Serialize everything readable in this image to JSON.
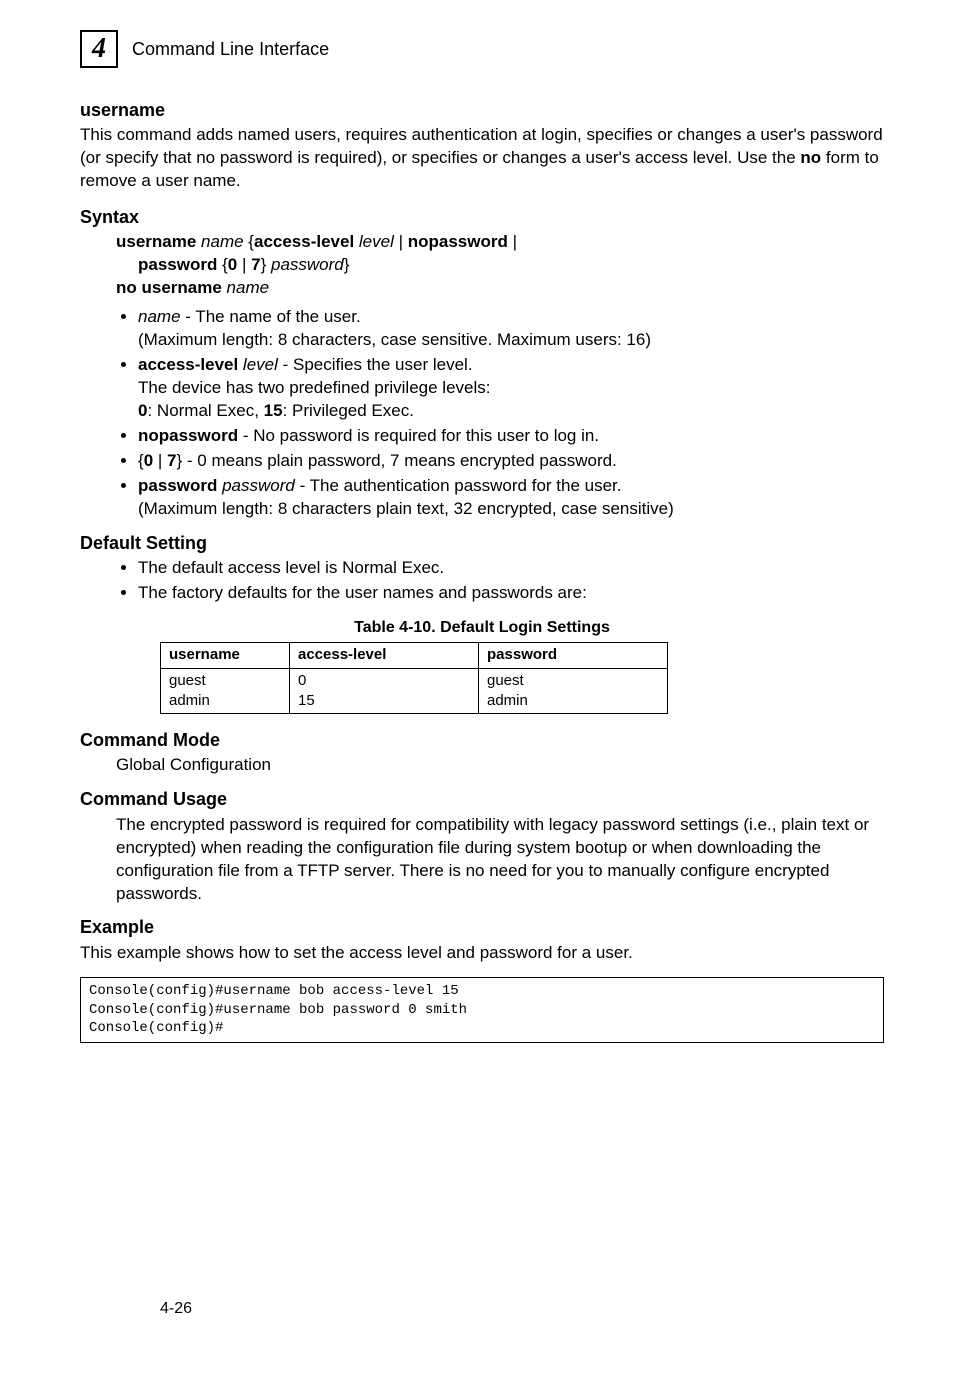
{
  "header": {
    "chapter_number": "4",
    "section": "Command Line Interface"
  },
  "cmd": {
    "name": "username",
    "intro_1": "This command adds named users, requires authentication at login, specifies or changes a user's password (or specify that no password is required), or specifies or changes a user's access level. Use the ",
    "intro_no": "no",
    "intro_2": " form to remove a user name."
  },
  "syntax": {
    "heading": "Syntax",
    "line1_a": "username ",
    "line1_name": "name",
    "line1_b": " {",
    "line1_access": "access-level ",
    "line1_level": "level",
    "line1_pipe1": " | ",
    "line1_nopass": "nopassword",
    "line1_pipe2": " |",
    "line2_a": "password",
    "line2_b": " {",
    "line2_0": "0",
    "line2_pipe": " | ",
    "line2_7": "7",
    "line2_c": "} ",
    "line2_pw": "password",
    "line2_close": "}",
    "line3_a": "no username ",
    "line3_name": "name",
    "bul_name_em": "name",
    "bul_name_txt": " - The name of the user.",
    "bul_name_note": "(Maximum length: 8 characters, case sensitive. Maximum users: 16)",
    "bul_access_b": "access-level",
    "bul_access_em": " level",
    "bul_access_txt": " - Specifies the user level.",
    "bul_access_note1": "The device has two predefined privilege levels:",
    "bul_access_note2_a": "0",
    "bul_access_note2_b": ": Normal Exec, ",
    "bul_access_note2_c": "15",
    "bul_access_note2_d": ": Privileged Exec.",
    "bul_nopass_b": "nopassword",
    "bul_nopass_txt": " - No password is required for this user to log in.",
    "bul_07_a": "{",
    "bul_07_0": "0",
    "bul_07_pipe": " | ",
    "bul_07_7": "7",
    "bul_07_b": "} - 0 means plain password, 7 means encrypted password.",
    "bul_pw_b": "password",
    "bul_pw_em": " password",
    "bul_pw_txt": " - The authentication password for the user.",
    "bul_pw_note": "(Maximum length: 8 characters plain text, 32 encrypted, case sensitive)"
  },
  "default": {
    "heading": "Default Setting",
    "b1": "The default access level is Normal Exec.",
    "b2": "The factory defaults for the user names and passwords are:"
  },
  "table": {
    "caption": "Table 4-10.   Default Login Settings",
    "h1": "username",
    "h2": "access-level",
    "h3": "password",
    "r1c1": "guest",
    "r1c2": "0",
    "r1c3": "guest",
    "r2c1": "admin",
    "r2c2": "15",
    "r2c3": "admin"
  },
  "mode": {
    "heading": "Command Mode",
    "text": "Global Configuration"
  },
  "usage": {
    "heading": "Command Usage",
    "text": "The encrypted password is required for compatibility with legacy password settings (i.e., plain text or encrypted) when reading the configuration file during system bootup or when downloading the configuration file from a TFTP server. There is no need for you to manually configure encrypted passwords."
  },
  "example": {
    "heading": "Example",
    "intro": "This example shows how to set the access level and password for a user.",
    "code": "Console(config)#username bob access-level 15\nConsole(config)#username bob password 0 smith\nConsole(config)#"
  },
  "page": "4-26",
  "chart_data": {
    "type": "table",
    "title": "Table 4-10. Default Login Settings",
    "columns": [
      "username",
      "access-level",
      "password"
    ],
    "rows": [
      [
        "guest",
        0,
        "guest"
      ],
      [
        "admin",
        15,
        "admin"
      ]
    ]
  }
}
